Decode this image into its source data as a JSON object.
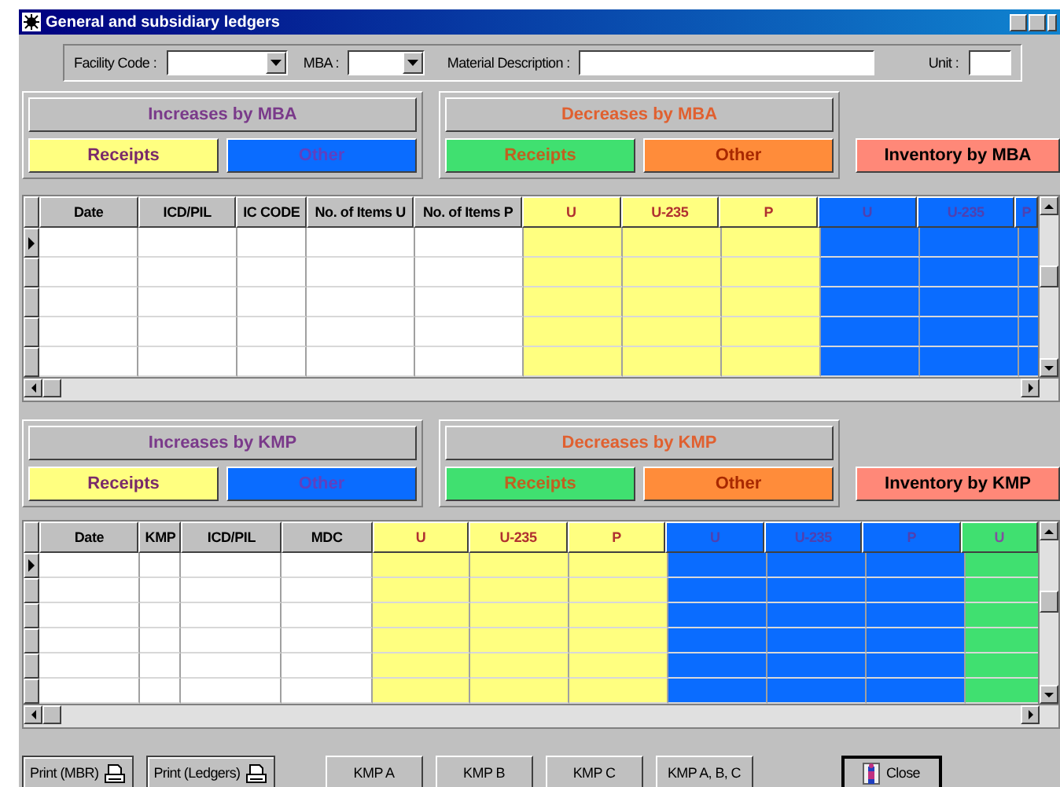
{
  "window": {
    "title": "General and subsidiary ledgers"
  },
  "filters": [
    {
      "label": "Facility Code :",
      "kind": "combo"
    },
    {
      "label": "MBA :",
      "kind": "combo"
    },
    {
      "label": "Material Description :",
      "kind": "text"
    },
    {
      "label": "Unit :",
      "kind": "text"
    }
  ],
  "mba_section": {
    "groups": [
      {
        "title": "Increases by MBA",
        "kind": "increase",
        "buttons": [
          {
            "label": "Receipts",
            "color": "#ffff80"
          },
          {
            "label": "Other",
            "color": "#0a6cff"
          }
        ]
      },
      {
        "title": "Decreases by MBA",
        "kind": "decrease",
        "buttons": [
          {
            "label": "Receipts",
            "color": "#40e070"
          },
          {
            "label": "Other",
            "color": "#ff8c3a"
          }
        ]
      }
    ],
    "inventory_button": {
      "label": "Inventory by MBA",
      "color": "#ff8878"
    },
    "grid": {
      "columns": [
        {
          "label": "Date",
          "color": "#c0c0c0"
        },
        {
          "label": "ICD/PIL",
          "color": "#c0c0c0"
        },
        {
          "label": "IC CODE",
          "color": "#c0c0c0"
        },
        {
          "label": "No. of Items U",
          "color": "#c0c0c0"
        },
        {
          "label": "No. of Items P",
          "color": "#c0c0c0"
        },
        {
          "label": "U",
          "color": "#ffff80"
        },
        {
          "label": "U-235",
          "color": "#ffff80"
        },
        {
          "label": "P",
          "color": "#ffff80"
        },
        {
          "label": "U",
          "color": "#0a6cff"
        },
        {
          "label": "U-235",
          "color": "#0a6cff"
        },
        {
          "label": "P",
          "color": "#0a6cff"
        }
      ],
      "rows": [
        {
          "selected": true
        },
        {
          "selected": false
        },
        {
          "selected": false
        },
        {
          "selected": false
        },
        {
          "selected": false
        }
      ]
    }
  },
  "kmp_section": {
    "groups": [
      {
        "title": "Increases by KMP",
        "kind": "increase",
        "buttons": [
          {
            "label": "Receipts",
            "color": "#ffff80"
          },
          {
            "label": "Other",
            "color": "#0a6cff"
          }
        ]
      },
      {
        "title": "Decreases by KMP",
        "kind": "decrease",
        "buttons": [
          {
            "label": "Receipts",
            "color": "#40e070"
          },
          {
            "label": "Other",
            "color": "#ff8c3a"
          }
        ]
      }
    ],
    "inventory_button": {
      "label": "Inventory by KMP",
      "color": "#ff8878"
    },
    "grid": {
      "columns": [
        {
          "label": "Date",
          "color": "#c0c0c0"
        },
        {
          "label": "KMP",
          "color": "#c0c0c0"
        },
        {
          "label": "ICD/PIL",
          "color": "#c0c0c0"
        },
        {
          "label": "MDC",
          "color": "#c0c0c0"
        },
        {
          "label": "U",
          "color": "#ffff80"
        },
        {
          "label": "U-235",
          "color": "#ffff80"
        },
        {
          "label": "P",
          "color": "#ffff80"
        },
        {
          "label": "U",
          "color": "#0a6cff"
        },
        {
          "label": "U-235",
          "color": "#0a6cff"
        },
        {
          "label": "P",
          "color": "#0a6cff"
        },
        {
          "label": "U",
          "color": "#40e070"
        }
      ],
      "rows": [
        {
          "selected": true
        },
        {
          "selected": false
        },
        {
          "selected": false
        },
        {
          "selected": false
        },
        {
          "selected": false
        },
        {
          "selected": false
        }
      ]
    }
  },
  "buttons": [
    {
      "label": "Print (MBR)",
      "kind": "print"
    },
    {
      "label": "Print (Ledgers)",
      "kind": "print"
    },
    {
      "label": "KMP A",
      "kind": "plain"
    },
    {
      "label": "KMP B",
      "kind": "plain"
    },
    {
      "label": "KMP C",
      "kind": "plain"
    },
    {
      "label": "KMP A, B, C",
      "kind": "plain"
    },
    {
      "label": "Close",
      "kind": "close"
    }
  ]
}
